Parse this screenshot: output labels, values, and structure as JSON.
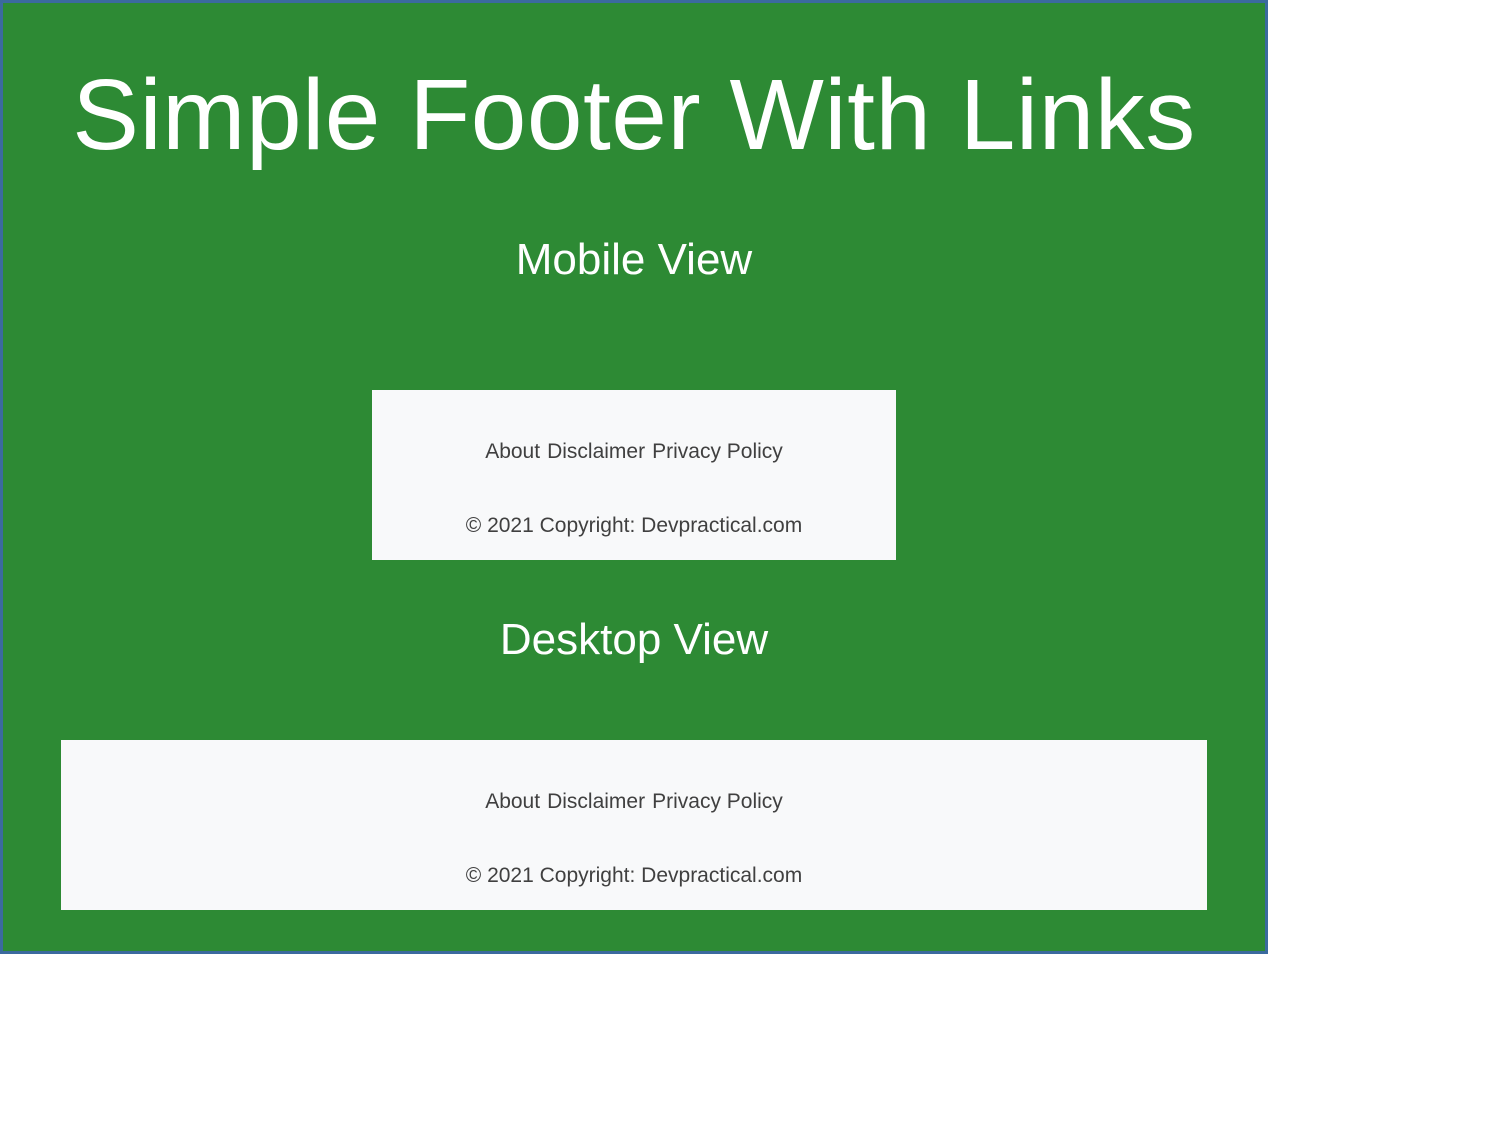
{
  "title": "Simple Footer With Links",
  "mobile": {
    "heading": "Mobile View",
    "links": {
      "about": "About",
      "disclaimer": "Disclaimer",
      "privacy": "Privacy Policy"
    },
    "copyright": "© 2021 Copyright: Devpractical.com"
  },
  "desktop": {
    "heading": "Desktop View",
    "links": {
      "about": "About",
      "disclaimer": "Disclaimer",
      "privacy": "Privacy Policy"
    },
    "copyright": "© 2021 Copyright: Devpractical.com"
  }
}
